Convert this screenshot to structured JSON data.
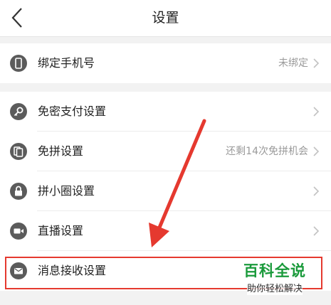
{
  "header": {
    "title": "设置"
  },
  "groups": [
    {
      "items": [
        {
          "label": "绑定手机号",
          "value": "未绑定",
          "icon": "phone-icon"
        }
      ]
    },
    {
      "items": [
        {
          "label": "免密支付设置",
          "value": "",
          "icon": "key-icon"
        },
        {
          "label": "免拼设置",
          "value": "还剩14次免拼机会",
          "icon": "cards-icon"
        },
        {
          "label": "拼小圈设置",
          "value": "",
          "icon": "lock-icon"
        },
        {
          "label": "直播设置",
          "value": "",
          "icon": "video-camera-icon"
        },
        {
          "label": "消息接收设置",
          "value": "",
          "icon": "envelope-icon"
        }
      ]
    }
  ],
  "watermark": {
    "title": "百科全说",
    "subtitle": "助你轻松解决"
  },
  "colors": {
    "annotation": "#e5392f",
    "icon": "#5b5b5b",
    "watermark": "#1a9a3b"
  }
}
